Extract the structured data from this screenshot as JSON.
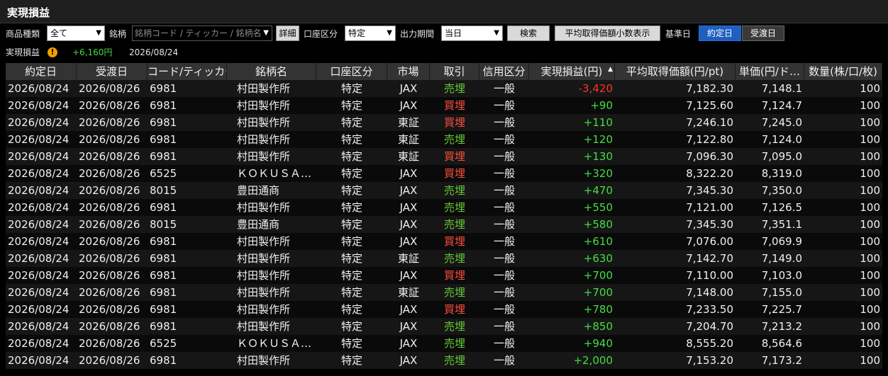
{
  "title": "実現損益",
  "toolbar": {
    "product_type_label": "商品種類",
    "product_type_value": "全て",
    "symbol_label": "銘柄",
    "symbol_placeholder": "銘柄コード / ティッカー / 銘柄名",
    "detail_button": "詳細",
    "account_label": "口座区分",
    "account_value": "特定",
    "period_label": "出力期間",
    "period_value": "当日",
    "search_button": "検索",
    "avg_price_button": "平均取得価額小数表示",
    "base_date_label": "基準日",
    "base_date_options": [
      "約定日",
      "受渡日"
    ],
    "base_date_selected": "約定日"
  },
  "summary": {
    "label": "実現損益",
    "warning_icon": "!",
    "value": "+6,160円",
    "date": "2026/08/24"
  },
  "colors": {
    "sell": "#66cc33",
    "buy": "#ff4d3d",
    "profit": "#44dd44",
    "loss": "#ff3322",
    "accent": "#1f5fbf"
  },
  "columns": [
    "約定日",
    "受渡日",
    "コード/ティッカー",
    "銘柄名",
    "口座区分",
    "市場",
    "取引",
    "信用区分",
    "実現損益(円)",
    "平均取得価額(円/pt)",
    "単価(円/ド…",
    "数量(株/口/枚)"
  ],
  "rows": [
    [
      "2026/08/24",
      "2026/08/26",
      "6981",
      "村田製作所",
      "特定",
      "JAX",
      "売埋",
      "一般",
      "-3,420",
      "7,182.30",
      "7,148.1",
      "100"
    ],
    [
      "2026/08/24",
      "2026/08/26",
      "6981",
      "村田製作所",
      "特定",
      "JAX",
      "買埋",
      "一般",
      "+90",
      "7,125.60",
      "7,124.7",
      "100"
    ],
    [
      "2026/08/24",
      "2026/08/26",
      "6981",
      "村田製作所",
      "特定",
      "東証",
      "買埋",
      "一般",
      "+110",
      "7,246.10",
      "7,245.0",
      "100"
    ],
    [
      "2026/08/24",
      "2026/08/26",
      "6981",
      "村田製作所",
      "特定",
      "東証",
      "売埋",
      "一般",
      "+120",
      "7,122.80",
      "7,124.0",
      "100"
    ],
    [
      "2026/08/24",
      "2026/08/26",
      "6981",
      "村田製作所",
      "特定",
      "東証",
      "買埋",
      "一般",
      "+130",
      "7,096.30",
      "7,095.0",
      "100"
    ],
    [
      "2026/08/24",
      "2026/08/26",
      "6525",
      "ＫＯＫＵＳＡ…",
      "特定",
      "JAX",
      "買埋",
      "一般",
      "+320",
      "8,322.20",
      "8,319.0",
      "100"
    ],
    [
      "2026/08/24",
      "2026/08/26",
      "8015",
      "豊田通商",
      "特定",
      "JAX",
      "売埋",
      "一般",
      "+470",
      "7,345.30",
      "7,350.0",
      "100"
    ],
    [
      "2026/08/24",
      "2026/08/26",
      "6981",
      "村田製作所",
      "特定",
      "JAX",
      "売埋",
      "一般",
      "+550",
      "7,121.00",
      "7,126.5",
      "100"
    ],
    [
      "2026/08/24",
      "2026/08/26",
      "8015",
      "豊田通商",
      "特定",
      "JAX",
      "売埋",
      "一般",
      "+580",
      "7,345.30",
      "7,351.1",
      "100"
    ],
    [
      "2026/08/24",
      "2026/08/26",
      "6981",
      "村田製作所",
      "特定",
      "JAX",
      "買埋",
      "一般",
      "+610",
      "7,076.00",
      "7,069.9",
      "100"
    ],
    [
      "2026/08/24",
      "2026/08/26",
      "6981",
      "村田製作所",
      "特定",
      "東証",
      "売埋",
      "一般",
      "+630",
      "7,142.70",
      "7,149.0",
      "100"
    ],
    [
      "2026/08/24",
      "2026/08/26",
      "6981",
      "村田製作所",
      "特定",
      "JAX",
      "買埋",
      "一般",
      "+700",
      "7,110.00",
      "7,103.0",
      "100"
    ],
    [
      "2026/08/24",
      "2026/08/26",
      "6981",
      "村田製作所",
      "特定",
      "東証",
      "売埋",
      "一般",
      "+700",
      "7,148.00",
      "7,155.0",
      "100"
    ],
    [
      "2026/08/24",
      "2026/08/26",
      "6981",
      "村田製作所",
      "特定",
      "JAX",
      "買埋",
      "一般",
      "+780",
      "7,233.50",
      "7,225.7",
      "100"
    ],
    [
      "2026/08/24",
      "2026/08/26",
      "6981",
      "村田製作所",
      "特定",
      "JAX",
      "売埋",
      "一般",
      "+850",
      "7,204.70",
      "7,213.2",
      "100"
    ],
    [
      "2026/08/24",
      "2026/08/26",
      "6525",
      "ＫＯＫＵＳＡ…",
      "特定",
      "JAX",
      "売埋",
      "一般",
      "+940",
      "8,555.20",
      "8,564.6",
      "100"
    ],
    [
      "2026/08/24",
      "2026/08/26",
      "6981",
      "村田製作所",
      "特定",
      "JAX",
      "売埋",
      "一般",
      "+2,000",
      "7,153.20",
      "7,173.2",
      "100"
    ]
  ]
}
